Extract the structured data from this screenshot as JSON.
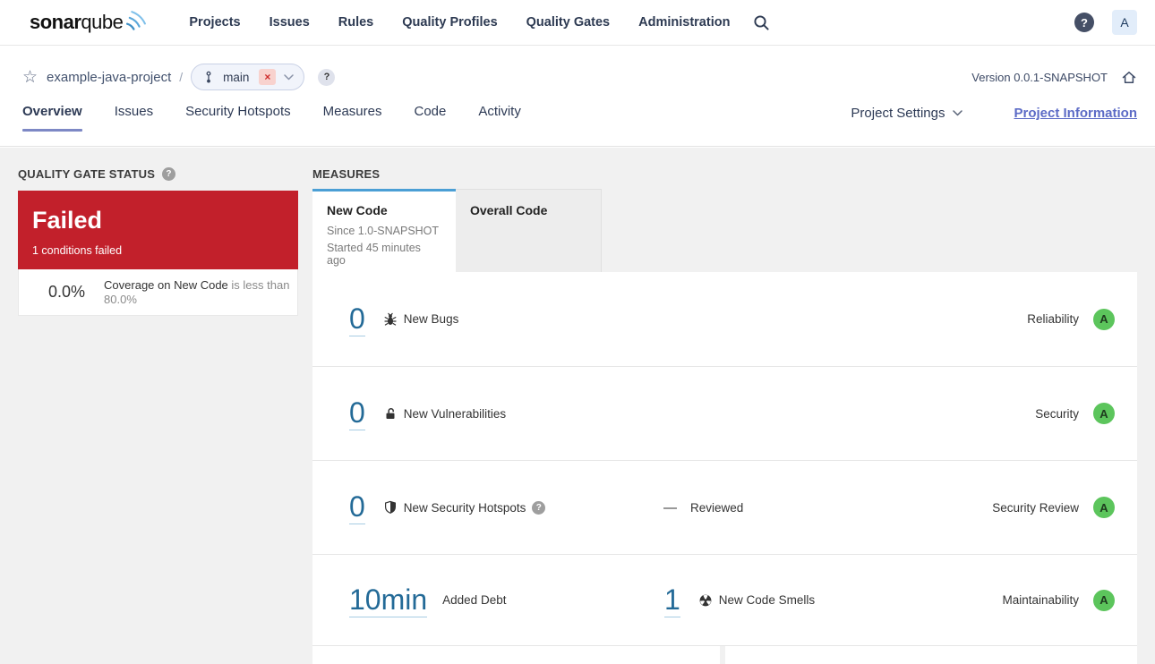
{
  "navbar": {
    "logo": {
      "bold": "sonar",
      "light": "qube"
    },
    "items": [
      "Projects",
      "Issues",
      "Rules",
      "Quality Profiles",
      "Quality Gates",
      "Administration"
    ],
    "help": "?",
    "avatar": "A"
  },
  "breadcrumb": {
    "project": "example-java-project",
    "separator": "/",
    "branch": "main",
    "branch_badge": "×",
    "branch_help": "?",
    "version": "Version 0.0.1-SNAPSHOT"
  },
  "project_tabs": [
    "Overview",
    "Issues",
    "Security Hotspots",
    "Measures",
    "Code",
    "Activity"
  ],
  "header_actions": {
    "project_settings": "Project Settings",
    "project_information": "Project Information"
  },
  "quality_gate": {
    "title": "QUALITY GATE STATUS",
    "help": "?",
    "status": "Failed",
    "conditions_failed": "1 conditions failed",
    "condition": {
      "value": "0.0%",
      "metric": "Coverage on New Code",
      "comparison": "is less than 80.0%"
    }
  },
  "measures": {
    "title": "MEASURES",
    "tabs": {
      "new_code": {
        "label": "New Code",
        "since": "Since 1.0-SNAPSHOT",
        "started": "Started 45 minutes ago"
      },
      "overall_code": {
        "label": "Overall Code"
      }
    },
    "rows": [
      {
        "value": "0",
        "label": "New Bugs",
        "rating_label": "Reliability",
        "rating": "A"
      },
      {
        "value": "0",
        "label": "New Vulnerabilities",
        "rating_label": "Security",
        "rating": "A"
      },
      {
        "value": "0",
        "label": "New Security Hotspots",
        "help": "?",
        "dash": "—",
        "reviewed_label": "Reviewed",
        "rating_label": "Security Review",
        "rating": "A"
      },
      {
        "value": "10min",
        "label": "Added Debt",
        "value2": "1",
        "label2": "New Code Smells",
        "rating_label": "Maintainability",
        "rating": "A"
      }
    ]
  },
  "colors": {
    "failed_red": "#c2202b",
    "rating_a_green": "#5cc55c",
    "link_blue": "#236a97",
    "active_tab_blue": "#4b9fd5",
    "overview_underline": "#7d88c5",
    "project_information_link": "#5c6bc6"
  }
}
